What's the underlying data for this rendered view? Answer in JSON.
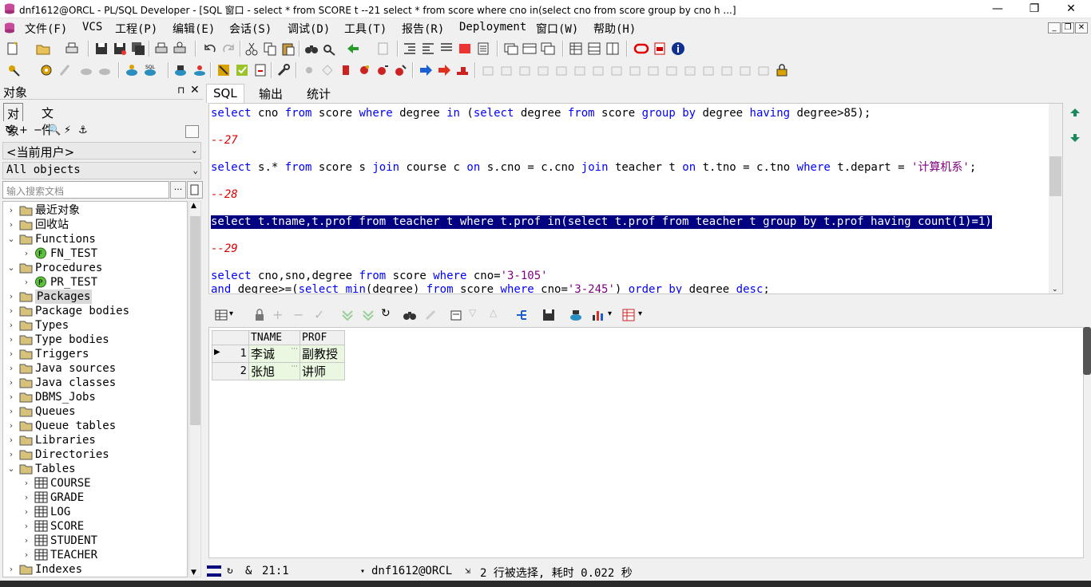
{
  "window": {
    "title": "dnf1612@ORCL - PL/SQL Developer - [SQL 窗口 - select * from SCORE t --21 select * from score where cno in(select cno from score group by cno h ...]",
    "minimize": "—",
    "restore": "❐",
    "close": "✕"
  },
  "menu": {
    "items": [
      "文件(F)",
      "VCS",
      "工程(P)",
      "编辑(E)",
      "会话(S)",
      "调试(D)",
      "工具(T)",
      "报告(R)",
      "Deployment",
      "窗口(W)",
      "帮助(H)"
    ],
    "mdi_buttons": [
      "_",
      "❐",
      "✕"
    ]
  },
  "left_panel": {
    "title": "对象",
    "pin": "⊓",
    "close": "✕",
    "tabs": [
      "对象",
      "文件"
    ],
    "tools": [
      "↻",
      "+",
      "−",
      "🔍",
      "⚡",
      "⚓"
    ],
    "user_combo": "<当前用户>",
    "filter_combo": "All objects",
    "search_placeholder": "输入搜索文档",
    "search_btn": "...",
    "tree": [
      {
        "label": "最近对象",
        "icon": "folder-icon",
        "exp": "›",
        "level": 0
      },
      {
        "label": "回收站",
        "icon": "folder-icon",
        "exp": "›",
        "level": 0
      },
      {
        "label": "Functions",
        "icon": "folder-icon",
        "exp": "⌄",
        "level": 0
      },
      {
        "label": "FN_TEST",
        "icon": "function-icon",
        "exp": "›",
        "level": 1
      },
      {
        "label": "Procedures",
        "icon": "folder-icon",
        "exp": "⌄",
        "level": 0
      },
      {
        "label": "PR_TEST",
        "icon": "procedure-icon",
        "exp": "›",
        "level": 1
      },
      {
        "label": "Packages",
        "icon": "folder-icon",
        "exp": "›",
        "level": 0,
        "selected": true
      },
      {
        "label": "Package bodies",
        "icon": "folder-icon",
        "exp": "›",
        "level": 0
      },
      {
        "label": "Types",
        "icon": "folder-icon",
        "exp": "›",
        "level": 0
      },
      {
        "label": "Type bodies",
        "icon": "folder-icon",
        "exp": "›",
        "level": 0
      },
      {
        "label": "Triggers",
        "icon": "folder-icon",
        "exp": "›",
        "level": 0
      },
      {
        "label": "Java sources",
        "icon": "folder-icon",
        "exp": "›",
        "level": 0
      },
      {
        "label": "Java classes",
        "icon": "folder-icon",
        "exp": "›",
        "level": 0
      },
      {
        "label": "DBMS_Jobs",
        "icon": "folder-icon",
        "exp": "›",
        "level": 0
      },
      {
        "label": "Queues",
        "icon": "folder-icon",
        "exp": "›",
        "level": 0
      },
      {
        "label": "Queue tables",
        "icon": "folder-icon",
        "exp": "›",
        "level": 0
      },
      {
        "label": "Libraries",
        "icon": "folder-icon",
        "exp": "›",
        "level": 0
      },
      {
        "label": "Directories",
        "icon": "folder-icon",
        "exp": "›",
        "level": 0
      },
      {
        "label": "Tables",
        "icon": "folder-icon",
        "exp": "⌄",
        "level": 0
      },
      {
        "label": "COURSE",
        "icon": "table-icon",
        "exp": "›",
        "level": 1
      },
      {
        "label": "GRADE",
        "icon": "table-icon",
        "exp": "›",
        "level": 1
      },
      {
        "label": "LOG",
        "icon": "table-icon",
        "exp": "›",
        "level": 1
      },
      {
        "label": "SCORE",
        "icon": "table-icon",
        "exp": "›",
        "level": 1
      },
      {
        "label": "STUDENT",
        "icon": "table-icon",
        "exp": "›",
        "level": 1
      },
      {
        "label": "TEACHER",
        "icon": "table-icon",
        "exp": "›",
        "level": 1
      },
      {
        "label": "Indexes",
        "icon": "folder-icon",
        "exp": "›",
        "level": 0
      }
    ]
  },
  "sql_tabs": [
    "SQL",
    "输出",
    "统计"
  ],
  "editor": {
    "lines": [
      {
        "text": "select cno from score where degree in (select degree from score group by degree having degree>85);",
        "kind": "code"
      },
      {
        "text": "--27",
        "kind": "comment"
      },
      {
        "text": "select s.* from score s join course c on s.cno = c.cno join teacher t on t.tno = c.tno where t.depart = '计算机系';",
        "kind": "code"
      },
      {
        "text": "--28",
        "kind": "comment"
      },
      {
        "text": "select t.tname,t.prof from teacher t where t.prof in(select t.prof from teacher t group by t.prof having count(1)=1)",
        "kind": "selected"
      },
      {
        "text": "--29",
        "kind": "comment"
      },
      {
        "text": "select cno,sno,degree from score where cno='3-105'",
        "kind": "code"
      },
      {
        "text": "and degree>=(select min(degree) from score where cno='3-245') order by degree desc;",
        "kind": "code"
      }
    ]
  },
  "results": {
    "columns": [
      "TNAME",
      "PROF"
    ],
    "rows": [
      {
        "n": "1",
        "tname": "李诚",
        "prof": "副教授"
      },
      {
        "n": "2",
        "tname": "张旭",
        "prof": "讲师"
      }
    ],
    "row_marker": "▶",
    "ellipsis": "···"
  },
  "status": {
    "position": "21:1",
    "amp": "&",
    "connection": "dnf1612@ORCL",
    "message": "2 行被选择, 耗时 0.022 秒",
    "conn_arrow": "▾"
  },
  "colors": {
    "keyword": "#0000ff",
    "comment": "#e00000",
    "string": "#800080",
    "selection_bg": "#000080",
    "grid_green": "#eaf8e2"
  }
}
